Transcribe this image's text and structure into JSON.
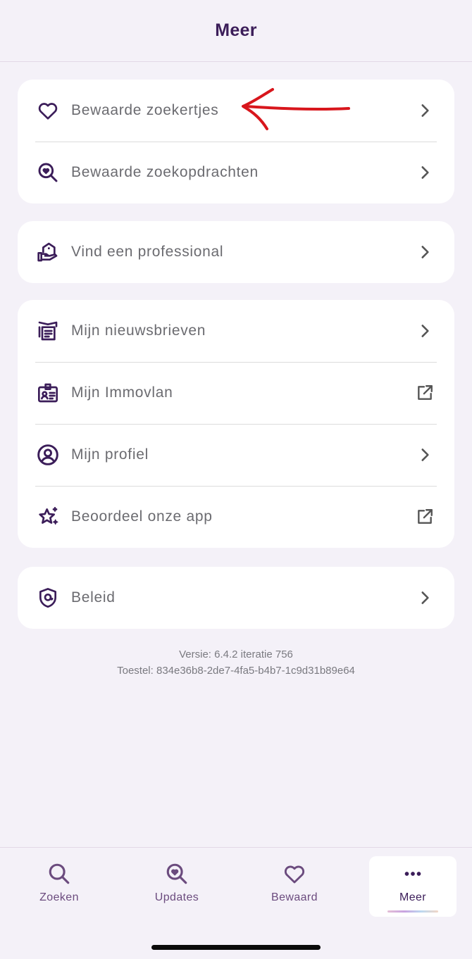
{
  "header": {
    "title": "Meer"
  },
  "sections": [
    {
      "items": [
        {
          "label": "Bewaarde zoekertjes",
          "icon": "heart-icon",
          "trail": "chevron-right-icon"
        },
        {
          "label": "Bewaarde zoekopdrachten",
          "icon": "search-heart-icon",
          "trail": "chevron-right-icon"
        }
      ]
    },
    {
      "items": [
        {
          "label": "Vind een professional",
          "icon": "house-hand-icon",
          "trail": "chevron-right-icon"
        }
      ]
    },
    {
      "items": [
        {
          "label": "Mijn nieuwsbrieven",
          "icon": "newsletter-icon",
          "trail": "chevron-right-icon"
        },
        {
          "label": "Mijn Immovlan",
          "icon": "id-badge-icon",
          "trail": "external-link-icon"
        },
        {
          "label": "Mijn profiel",
          "icon": "user-circle-icon",
          "trail": "chevron-right-icon"
        },
        {
          "label": "Beoordeel onze app",
          "icon": "star-sparkle-icon",
          "trail": "external-link-icon"
        }
      ]
    },
    {
      "items": [
        {
          "label": "Beleid",
          "icon": "shield-icon",
          "trail": "chevron-right-icon"
        }
      ]
    }
  ],
  "info": {
    "version": "Versie: 6.4.2 iteratie 756",
    "device": "Toestel: 834e36b8-2de7-4fa5-b4b7-1c9d31b89e64"
  },
  "tabs": [
    {
      "label": "Zoeken",
      "icon": "search-icon",
      "active": false
    },
    {
      "label": "Updates",
      "icon": "search-heart-icon",
      "active": false
    },
    {
      "label": "Bewaard",
      "icon": "heart-icon",
      "active": false
    },
    {
      "label": "Meer",
      "icon": "more-dots-icon",
      "active": true
    }
  ],
  "colors": {
    "accent": "#3b1d59",
    "background": "#f4f1f8",
    "annotation_arrow": "#d8161c"
  }
}
